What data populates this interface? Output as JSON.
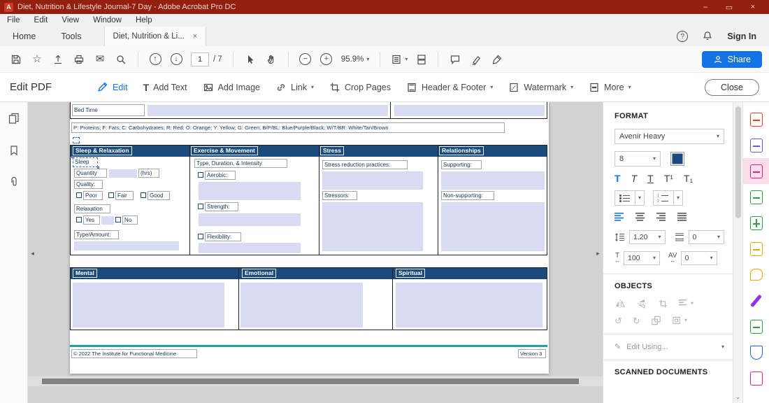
{
  "titlebar": {
    "title": "Diet, Nutrition & Lifestyle Journal-7 Day - Adobe Acrobat Pro DC"
  },
  "menubar": {
    "items": [
      "File",
      "Edit",
      "View",
      "Window",
      "Help"
    ]
  },
  "tabbar": {
    "home": "Home",
    "tools": "Tools",
    "document": "Diet, Nutrition & Li...",
    "sign_in": "Sign In"
  },
  "toolbar": {
    "page_number": "1",
    "page_total": "/ 7",
    "zoom": "95.9%",
    "share": "Share"
  },
  "editbar": {
    "title": "Edit PDF",
    "edit": "Edit",
    "add_text": "Add Text",
    "add_image": "Add Image",
    "link": "Link",
    "crop_pages": "Crop Pages",
    "header_footer": "Header & Footer",
    "watermark": "Watermark",
    "more": "More",
    "close": "Close"
  },
  "page": {
    "bed_time": "Bed Time",
    "legend": "P: Proteins; F: Fats; C: Carbohydrates; R: Red; O: Orange; Y: Yellow; G: Green; B/P/BL: Blue/Purple/Black; W/T/BR: White/Tan/Brown",
    "table1": {
      "headers": [
        "Sleep & Relaxation",
        "Exercise & Movement",
        "Stress",
        "Relationships"
      ]
    },
    "sleep": {
      "title": "Sleep",
      "quantity": "Quantity",
      "hrs": "(hrs)",
      "quality": "Quality:",
      "poor": "Poor",
      "fair": "Fair",
      "good": "Good",
      "relaxation": "Relaxation",
      "yes": "Yes",
      "no": "No",
      "type_amount": "Type/Amount:"
    },
    "exercise": {
      "subtitle": "Type, Duration, & Intensity",
      "aerobic": "Aerobic:",
      "strength": "Strength:",
      "flexibility": "Flexibility:"
    },
    "stress": {
      "practices": "Stress reduction practices:",
      "stressors": "Stressors:"
    },
    "relationships": {
      "supporting": "Supporting:",
      "non_supporting": "Non-supporting:"
    },
    "table2": {
      "headers": [
        "Mental",
        "Emotional",
        "Spiritual"
      ]
    },
    "footer": {
      "copyright": "© 2022 The Institute for Functional Medicine",
      "version": "Version 3"
    }
  },
  "format_panel": {
    "title": "FORMAT",
    "font": "Avenir Heavy",
    "size": "8",
    "line_spacing": "1.20",
    "paragraph_spacing": "0",
    "horizontal_scale": "100",
    "char_spacing": "0",
    "objects_title": "OBJECTS",
    "edit_using": "Edit Using...",
    "scanned_title": "SCANNED DOCUMENTS"
  },
  "icons": {
    "logo": "A",
    "min": "–",
    "max": "▭",
    "close": "×",
    "caret": "▾",
    "star": "☆",
    "envelope": "✉",
    "up": "↑",
    "down": "↓",
    "minus": "−",
    "plus": "+",
    "help": "?",
    "add_text_t": "T",
    "t_bold": "T",
    "t_italic": "T",
    "t_underline": "T",
    "t_sup": "T¹",
    "t_sub": "T₁",
    "t_scale": "T",
    "av": "AV",
    "h_arrow": "↔",
    "pencil": "✎",
    "rotate_ccw": "↺",
    "rotate_cw": "↻",
    "left_chevron": "◂",
    "right_chevron": "▸",
    "chevron_down": "⌄"
  },
  "colors": {
    "accent_blue": "#1473e6",
    "titlebar_red": "#93200f",
    "table_header_navy": "#1b4b7c",
    "field_lavender": "#d9dbf2",
    "footer_teal": "#19a69e",
    "edit_tool_pink": "#e0218a"
  }
}
